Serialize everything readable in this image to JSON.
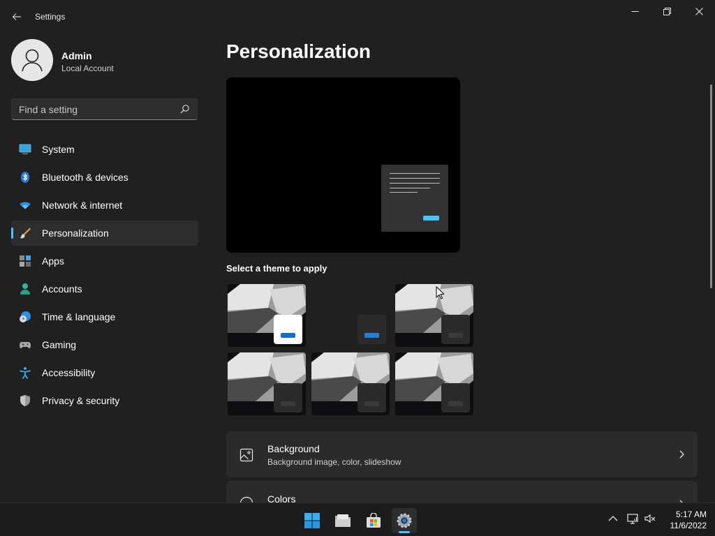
{
  "window": {
    "title": "Settings"
  },
  "profile": {
    "name": "Admin",
    "account_type": "Local Account"
  },
  "search": {
    "placeholder": "Find a setting"
  },
  "nav": {
    "items": [
      {
        "label": "System",
        "icon": "system-icon"
      },
      {
        "label": "Bluetooth & devices",
        "icon": "bluetooth-icon"
      },
      {
        "label": "Network & internet",
        "icon": "wifi-icon"
      },
      {
        "label": "Personalization",
        "icon": "brush-icon",
        "active": true
      },
      {
        "label": "Apps",
        "icon": "apps-icon"
      },
      {
        "label": "Accounts",
        "icon": "person-icon"
      },
      {
        "label": "Time & language",
        "icon": "clock-globe-icon"
      },
      {
        "label": "Gaming",
        "icon": "gamepad-icon"
      },
      {
        "label": "Accessibility",
        "icon": "accessibility-icon"
      },
      {
        "label": "Privacy & security",
        "icon": "shield-icon"
      }
    ]
  },
  "main": {
    "title": "Personalization",
    "themes_label": "Select a theme to apply",
    "settings": [
      {
        "title": "Background",
        "subtitle": "Background image, color, slideshow",
        "icon": "image-icon"
      },
      {
        "title": "Colors",
        "subtitle": "",
        "icon": "palette-icon"
      }
    ]
  },
  "taskbar": {
    "apps": [
      "start-icon",
      "file-explorer-icon",
      "store-icon",
      "settings-icon"
    ],
    "tray": [
      "chevron-up-icon",
      "network-icon",
      "volume-muted-icon"
    ],
    "time": "5:17 AM",
    "date": "11/6/2022"
  },
  "colors": {
    "accent": "#4cc2ff",
    "background": "#202020",
    "card": "#2b2b2b"
  }
}
